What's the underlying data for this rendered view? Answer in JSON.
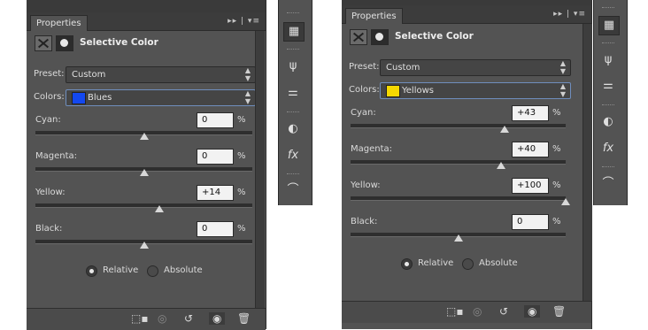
{
  "left": {
    "tab": "Properties",
    "tab_controls": "▸▸ | ▾≡",
    "title": "Selective Color",
    "preset_label": "Preset:",
    "preset_value": "Custom",
    "colors_label": "Colors:",
    "colors_value": "Blues",
    "swatch_color": "#1348f0",
    "sliders": [
      {
        "label": "Cyan:",
        "value": "0",
        "unit": "%",
        "percent": 0
      },
      {
        "label": "Magenta:",
        "value": "0",
        "unit": "%",
        "percent": 0
      },
      {
        "label": "Yellow:",
        "value": "+14",
        "unit": "%",
        "percent": 14
      },
      {
        "label": "Black:",
        "value": "0",
        "unit": "%",
        "percent": 0
      }
    ],
    "radio_relative": "Relative",
    "radio_absolute": "Absolute"
  },
  "right": {
    "tab": "Properties",
    "tab_controls": "▸▸ | ▾≡",
    "title": "Selective Color",
    "preset_label": "Preset:",
    "preset_value": "Custom",
    "colors_label": "Colors:",
    "colors_value": "Yellows",
    "swatch_color": "#f5d800",
    "sliders": [
      {
        "label": "Cyan:",
        "value": "+43",
        "unit": "%",
        "percent": 43
      },
      {
        "label": "Magenta:",
        "value": "+40",
        "unit": "%",
        "percent": 40
      },
      {
        "label": "Yellow:",
        "value": "+100",
        "unit": "%",
        "percent": 100
      },
      {
        "label": "Black:",
        "value": "0",
        "unit": "%",
        "percent": 0
      }
    ],
    "radio_relative": "Relative",
    "radio_absolute": "Absolute"
  },
  "bottom_icons": [
    "clip-to-layer-icon",
    "visibility-toggle-icon",
    "reset-icon",
    "eye-icon",
    "trash-icon"
  ],
  "dock_icons": [
    "adjustments-icon",
    "brushes-icon",
    "brush-presets-icon",
    "styles-icon",
    "fx-icon",
    "paths-icon"
  ]
}
